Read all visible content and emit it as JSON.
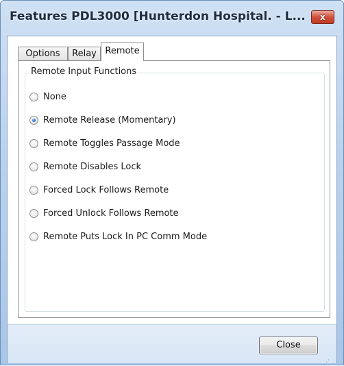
{
  "window": {
    "title": "Features PDL3000 [Hunterdon Hospital. - L...",
    "close_glyph": "x"
  },
  "tabs": [
    {
      "label": "Options",
      "active": false
    },
    {
      "label": "Relay",
      "active": false
    },
    {
      "label": "Remote",
      "active": true
    }
  ],
  "group": {
    "label": "Remote Input Functions",
    "options": [
      {
        "label": "None",
        "selected": false
      },
      {
        "label": "Remote Release (Momentary)",
        "selected": true
      },
      {
        "label": "Remote Toggles Passage Mode",
        "selected": false
      },
      {
        "label": "Remote Disables Lock",
        "selected": false
      },
      {
        "label": "Forced Lock Follows Remote",
        "selected": false
      },
      {
        "label": "Forced Unlock Follows Remote",
        "selected": false
      },
      {
        "label": "Remote Puts Lock In PC Comm Mode",
        "selected": false
      }
    ]
  },
  "footer": {
    "close_label": "Close"
  },
  "colors": {
    "titlebar": "#b9d1ec",
    "close_button_red": "#c03a25",
    "radio_selected": "#2a6bd1"
  }
}
